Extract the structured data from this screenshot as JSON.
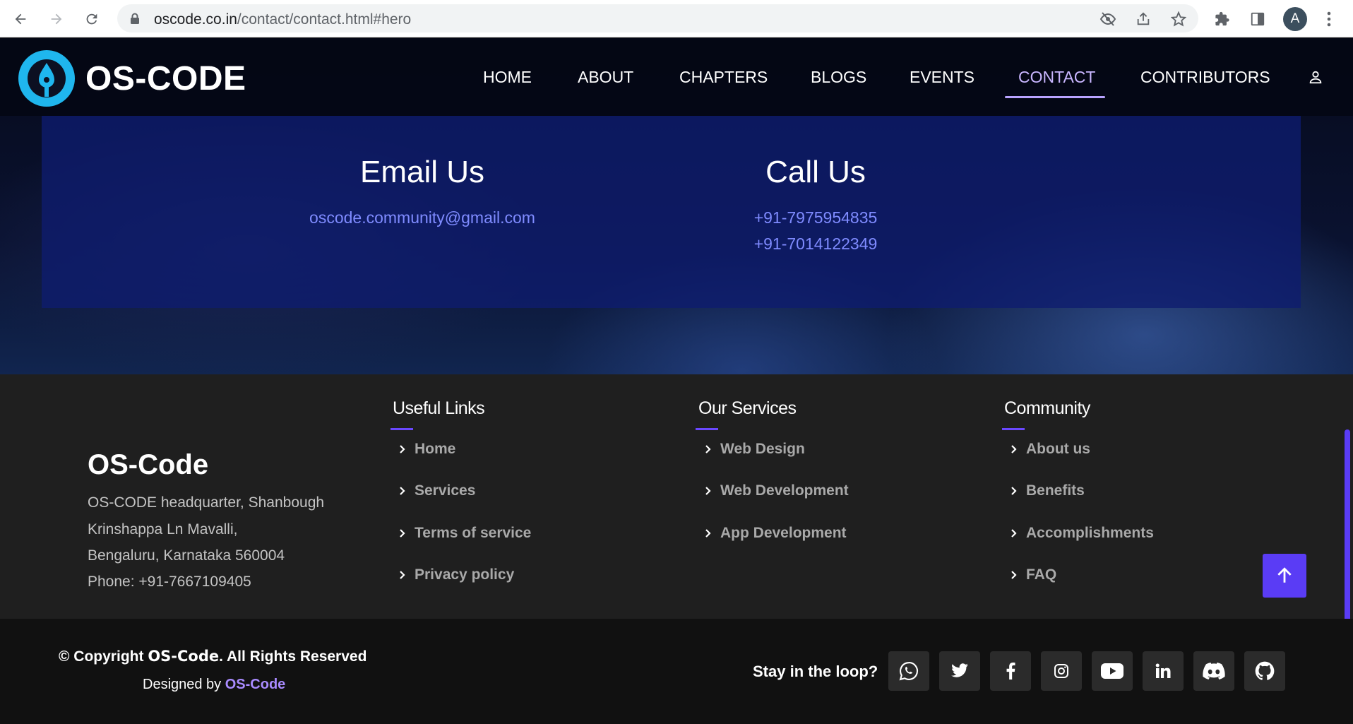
{
  "browser": {
    "url_host": "oscode.co.in",
    "url_path": "/contact/contact.html#hero",
    "profile_initial": "A"
  },
  "site": {
    "logo_text": "OS-CODE",
    "nav": [
      {
        "label": "HOME",
        "active": false
      },
      {
        "label": "ABOUT",
        "active": false
      },
      {
        "label": "CHAPTERS",
        "active": false
      },
      {
        "label": "BLOGS",
        "active": false
      },
      {
        "label": "EVENTS",
        "active": false
      },
      {
        "label": "CONTACT",
        "active": true
      },
      {
        "label": "CONTRIBUTORS",
        "active": false
      }
    ]
  },
  "contact": {
    "email_title": "Email Us",
    "email": "oscode.community@gmail.com",
    "call_title": "Call Us",
    "phones": [
      "+91-7975954835",
      "+91-7014122349"
    ]
  },
  "footer": {
    "brand": "OS-Code",
    "address": [
      "OS-CODE headquarter, Shanbough",
      "Krinshappa Ln Mavalli,",
      "Bengaluru, Karnataka 560004",
      "Phone: +91-7667109405"
    ],
    "columns": [
      {
        "title": "Useful Links",
        "links": [
          "Home",
          "Services",
          "Terms of service",
          "Privacy policy"
        ]
      },
      {
        "title": "Our Services",
        "links": [
          "Web Design",
          "Web Development",
          "App Development"
        ]
      },
      {
        "title": "Community",
        "links": [
          "About us",
          "Benefits",
          "Accomplishments",
          "FAQ"
        ]
      }
    ],
    "copyright_prefix": "© Copyright ",
    "copyright_brand": "OS-Code",
    "copyright_suffix": ". All Rights Reserved",
    "designed_prefix": "Designed by ",
    "designed_brand": "OS-Code",
    "loop_label": "Stay in the loop?",
    "social_icons": [
      "whatsapp-icon",
      "twitter-icon",
      "facebook-icon",
      "instagram-icon",
      "youtube-icon",
      "linkedin-icon",
      "discord-icon",
      "github-icon"
    ]
  },
  "colors": {
    "accent": "#5a3cf5",
    "link": "#7f8bff",
    "logo_blue": "#1fb6ee"
  }
}
